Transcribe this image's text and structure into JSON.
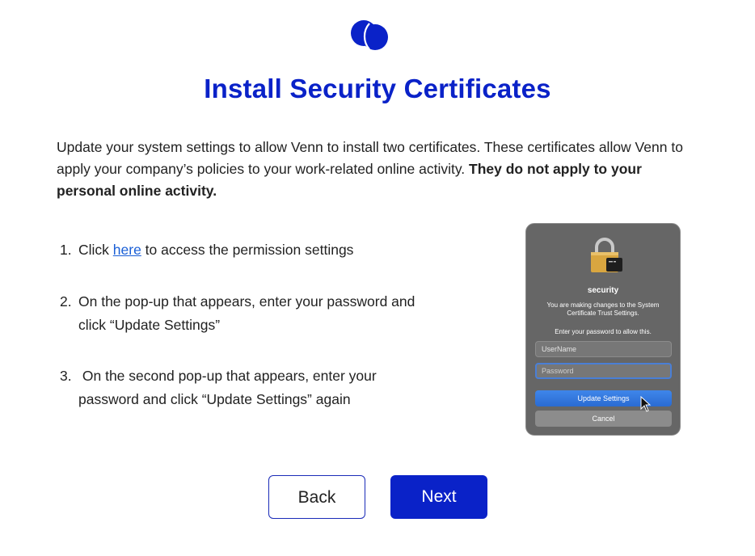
{
  "brand": {
    "logo_icon": "venn-logo-icon",
    "primary_color": "#0a22c8",
    "link_color": "#1a5fd6"
  },
  "header": {
    "title": "Install Security Certificates"
  },
  "intro": {
    "text": "Update your system settings to allow Venn to install two certificates. These certificates allow Venn to apply your company’s policies to your work-related online activity. ",
    "bold": "They do not apply to your personal online activity."
  },
  "steps": [
    {
      "num": "1.",
      "before": "Click ",
      "link": "here",
      "after": " to access the permission settings"
    },
    {
      "num": "2.",
      "text": "On the pop-up that appears, enter your password and click “Update Settings”"
    },
    {
      "num": "3.",
      "text": " On the second pop-up that appears, enter your password and click “Update Settings” again"
    }
  ],
  "dialog_preview": {
    "icon": "lock-icon",
    "heading": "security",
    "message": "You are making changes to the System Certificate Trust Settings.",
    "allow_text": "Enter your password to allow this.",
    "username_placeholder": "UserName",
    "password_placeholder": "Password",
    "update_label": "Update Settings",
    "cancel_label": "Cancel"
  },
  "nav": {
    "back_label": "Back",
    "next_label": "Next"
  }
}
